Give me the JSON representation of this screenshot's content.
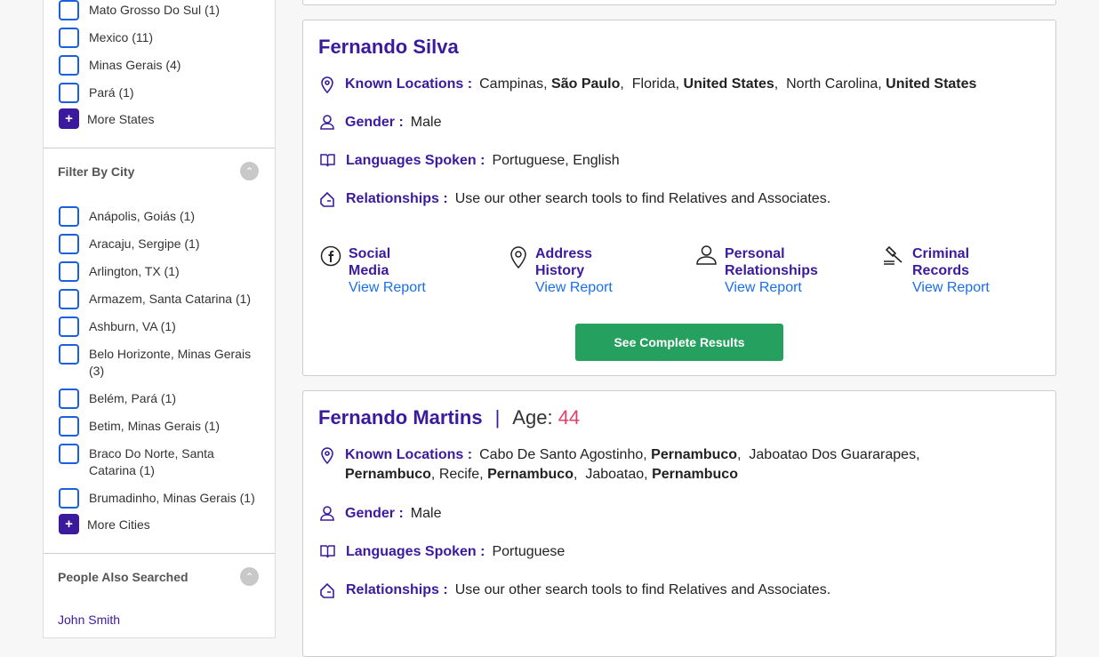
{
  "sidebar": {
    "states": [
      "Mato Grosso Do Sul (1)",
      "Mexico (11)",
      "Minas Gerais (4)",
      "Pará (1)"
    ],
    "more_states": "More States",
    "city_header": "Filter By City",
    "cities": [
      "Anápolis, Goiás (1)",
      "Aracaju, Sergipe (1)",
      "Arlington, TX (1)",
      "Armazem, Santa Catarina (1)",
      "Ashburn, VA (1)",
      "Belo Horizonte, Minas Gerais (3)",
      "Belém, Pará (1)",
      "Betim, Minas Gerais (1)",
      "Braco Do Norte, Santa Catarina (1)",
      "Brumadinho, Minas Gerais (1)"
    ],
    "more_cities": "More Cities",
    "people_header": "People Also Searched",
    "people": [
      "John Smith"
    ]
  },
  "labels": {
    "locations": "Known Locations :",
    "gender": "Gender :",
    "languages": "Languages Spoken :",
    "relationships": "Relationships :",
    "age": "Age:",
    "age_sep": "|"
  },
  "results": [
    {
      "name": "Fernando Silva",
      "locations": [
        [
          "Campinas, ",
          "São Paulo",
          ",  "
        ],
        [
          "Florida, ",
          "United States",
          ",  "
        ],
        [
          "North Carolina, ",
          "United States",
          ""
        ]
      ],
      "gender": "Male",
      "languages": "Portuguese, English",
      "relationships": "Use our other search tools to find Relatives and Associates.",
      "reports": [
        {
          "title": "Social Media",
          "link": "View Report",
          "icon": "facebook-icon"
        },
        {
          "title": "Address History",
          "link": "View Report",
          "icon": "map-pin-icon"
        },
        {
          "title": "Personal Relationships",
          "link": "View Report",
          "icon": "person-icon"
        },
        {
          "title": "Criminal Records",
          "link": "View Report",
          "icon": "gavel-icon"
        }
      ],
      "button": "See Complete Results"
    },
    {
      "name": "Fernando Martins",
      "age": "44",
      "locations": [
        [
          "Cabo De Santo Agostinho, ",
          "Pernambuco",
          ",  "
        ],
        [
          "Jaboatao Dos Guararapes, ",
          "Pernambuco",
          ", "
        ],
        [
          "Recife, ",
          "Pernambuco",
          ",  "
        ],
        [
          "Jaboatao, ",
          "Pernambuco",
          ""
        ]
      ],
      "gender": "Male",
      "languages": "Portuguese",
      "relationships": "Use our other search tools to find Relatives and Associates."
    }
  ],
  "colors": {
    "brand": "#3b1a9e",
    "link": "#1a6fe8",
    "button": "#26a05e",
    "age": "#e0406a"
  }
}
